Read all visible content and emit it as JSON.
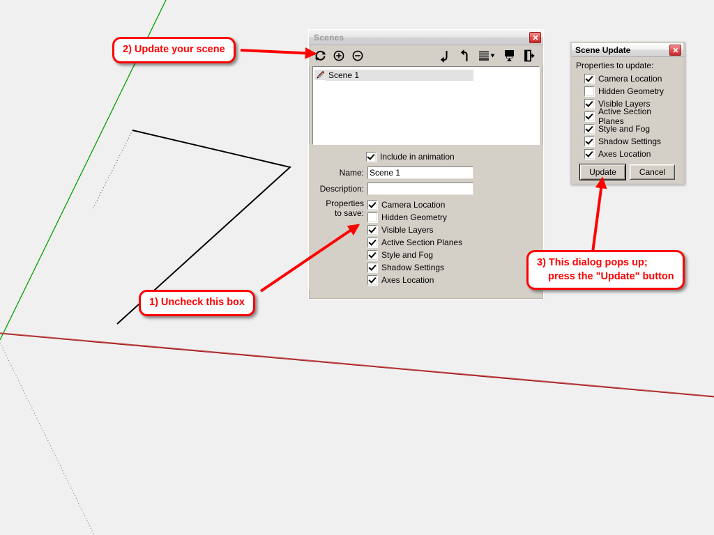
{
  "viewport": {
    "name": "sketchup-3d-viewport",
    "background_color": "#f0f0f0",
    "axes": {
      "red_axis_color": "#aa0000",
      "green_axis_color": "#00a800",
      "blue_axis_color": "#4444bb"
    },
    "geometry_edge_color": "#000000"
  },
  "scenes_panel": {
    "title": "Scenes",
    "close_label": "✕",
    "toolbar": {
      "update_scene_icon": "refresh-icon",
      "add_scene_icon": "plus-circle-icon",
      "remove_scene_icon": "minus-circle-icon",
      "move_down_icon": "arrow-down-hook-icon",
      "move_up_icon": "arrow-up-hook-icon",
      "view_options_icon": "list-view-icon",
      "view_options_caret": "chevron-down-icon",
      "show_details_icon": "show-details-icon",
      "panel_options_icon": "panel-options-icon"
    },
    "list": {
      "items": [
        {
          "icon": "pencil-icon",
          "label": "Scene 1"
        }
      ]
    },
    "include_in_animation": {
      "label": "Include in animation",
      "checked": true
    },
    "fields": [
      {
        "label": "Name:",
        "value": "Scene 1",
        "placeholder": ""
      },
      {
        "label": "Description:",
        "value": "",
        "placeholder": ""
      }
    ],
    "properties": {
      "label_line1": "Properties",
      "label_line2": "to save:",
      "items": [
        {
          "label": "Camera Location",
          "checked": true
        },
        {
          "label": "Hidden Geometry",
          "checked": false
        },
        {
          "label": "Visible Layers",
          "checked": true
        },
        {
          "label": "Active Section Planes",
          "checked": true
        },
        {
          "label": "Style and Fog",
          "checked": true
        },
        {
          "label": "Shadow Settings",
          "checked": true
        },
        {
          "label": "Axes Location",
          "checked": true
        }
      ]
    }
  },
  "scene_update_dialog": {
    "title": "Scene Update",
    "close_label": "✕",
    "section_label": "Properties to update:",
    "items": [
      {
        "label": "Camera Location",
        "checked": true
      },
      {
        "label": "Hidden Geometry",
        "checked": false
      },
      {
        "label": "Visible Layers",
        "checked": true
      },
      {
        "label": "Active Section Planes",
        "checked": true
      },
      {
        "label": "Style and Fog",
        "checked": true
      },
      {
        "label": "Shadow Settings",
        "checked": true
      },
      {
        "label": "Axes Location",
        "checked": true
      }
    ],
    "buttons": {
      "update": "Update",
      "cancel": "Cancel"
    }
  },
  "callouts": {
    "accent_color": "#ff0000",
    "items": [
      {
        "id": "callout-1",
        "text": "1) Uncheck this box"
      },
      {
        "id": "callout-2",
        "text": "2) Update your scene"
      },
      {
        "id": "callout-3",
        "text": "3) This dialog pops up;\n    press the \"Update\" button"
      }
    ]
  }
}
